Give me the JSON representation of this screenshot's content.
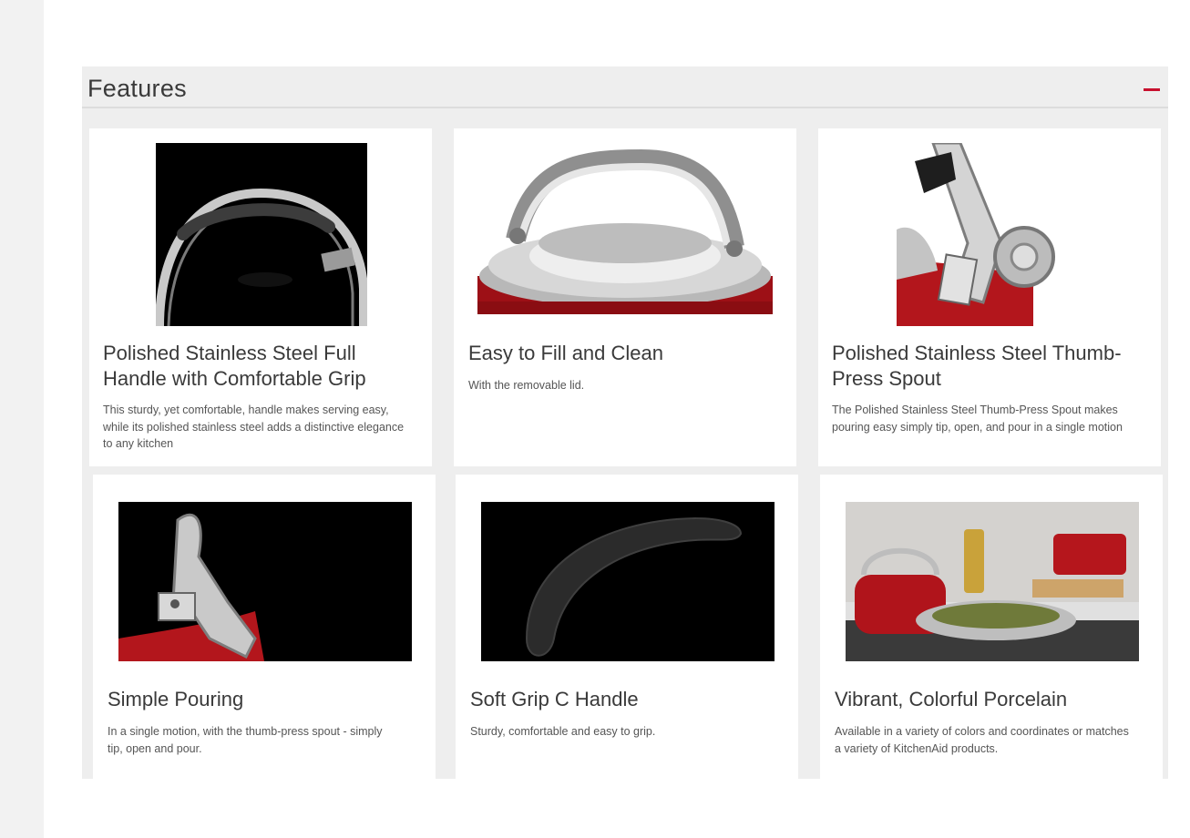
{
  "features": {
    "title": "Features",
    "collapse_icon": "minus-icon",
    "accent_color": "#c8102e",
    "cards": [
      {
        "title": "Polished Stainless Steel Full Handle with Comfortable Grip",
        "description": "This sturdy, yet comfortable, handle makes serving easy, while its polished stainless steel adds a distinctive elegance to any kitchen",
        "image": "kettle-full-handle-image"
      },
      {
        "title": "Easy to Fill and Clean",
        "description": "With the removable lid.",
        "image": "kettle-removable-lid-image"
      },
      {
        "title": "Polished Stainless Steel Thumb-Press Spout",
        "description": "The Polished Stainless Steel Thumb-Press Spout makes pouring easy simply tip, open, and pour in a single motion",
        "image": "kettle-thumb-press-spout-image"
      },
      {
        "title": "Simple Pouring",
        "description": "In a single motion, with the thumb-press spout - simply tip, open and pour.",
        "image": "kettle-spout-pouring-image"
      },
      {
        "title": "Soft Grip C Handle",
        "description": "Sturdy, comfortable and easy to grip.",
        "image": "soft-grip-c-handle-image"
      },
      {
        "title": "Vibrant, Colorful Porcelain",
        "description": "Available in a variety of colors and coordinates or matches a variety of KitchenAid products.",
        "image": "kitchen-scene-porcelain-image"
      }
    ]
  }
}
